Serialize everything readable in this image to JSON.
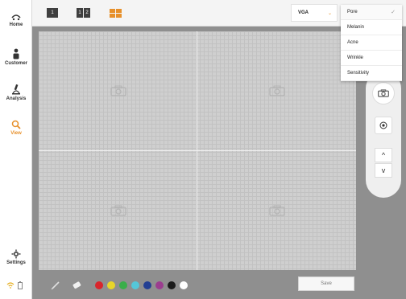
{
  "sidebar": {
    "items": [
      {
        "label": "Home",
        "icon": "home-icon"
      },
      {
        "label": "Customer",
        "icon": "customer-icon"
      },
      {
        "label": "Analysis",
        "icon": "microscope-icon"
      },
      {
        "label": "View",
        "icon": "magnifier-icon"
      }
    ],
    "settings_label": "Settings",
    "status_icons": [
      "wifi-icon",
      "battery-icon"
    ]
  },
  "topbar": {
    "layouts": [
      {
        "label": "1"
      },
      {
        "label": "1",
        "label2": "2"
      },
      {
        "label": "quad"
      }
    ],
    "resolution": "VGA",
    "resolution_chevron": "⌄"
  },
  "dropdown": {
    "items": [
      {
        "label": "Pore",
        "selected": true,
        "check": "✓"
      },
      {
        "label": "Melanin"
      },
      {
        "label": "Acne"
      },
      {
        "label": "Wrinkle"
      },
      {
        "label": "Sensitivity"
      }
    ]
  },
  "canvas": {
    "cells": [
      "camera-icon",
      "camera-icon",
      "camera-icon",
      "camera-icon"
    ]
  },
  "controls": {
    "up_arrow": "^",
    "down_arrow": "v"
  },
  "bottombar": {
    "tools": [
      "pen-icon",
      "eraser-icon"
    ],
    "palette": [
      "#d9252c",
      "#e8d52a",
      "#3aae4a",
      "#55c7d9",
      "#233f93",
      "#9b3d8f",
      "#1a1a1a",
      "#ffffff"
    ],
    "save_label": "Save"
  },
  "colors": {
    "accent": "#e7902a",
    "panel_bg": "#8f8f8f",
    "canvas_bg": "#cfcfcf"
  }
}
